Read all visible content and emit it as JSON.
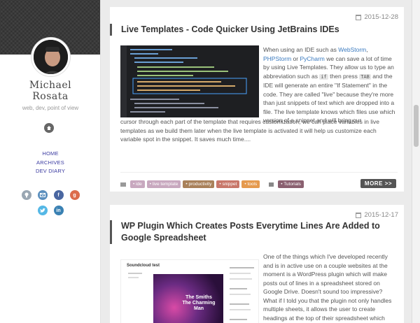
{
  "author": {
    "name_line1": "Michael",
    "name_line2": "Rosata",
    "tagline": "web, dev, point of view"
  },
  "nav": {
    "items": [
      "HOME",
      "ARCHIVES",
      "DEV DIARY"
    ]
  },
  "social": {
    "icons": [
      "lightbulb-icon",
      "email-icon",
      "facebook-icon",
      "google-plus-icon",
      "twitter-icon",
      "linkedin-icon"
    ],
    "colors": {
      "lightbulb": "#9aa7b3",
      "email": "#5b8fbe",
      "facebook": "#4a67a1",
      "google": "#dc6c4c",
      "twitter": "#55b8e6",
      "linkedin": "#3a81b3"
    }
  },
  "posts": [
    {
      "date": "2015-12-28",
      "title": "Live Templates - Code Quicker Using JetBrains IDEs",
      "excerpt_a": "When using an IDE such as ",
      "link1": "WebStorm",
      "sep1": ", ",
      "link2": "PHPStorm",
      "sep2": " or ",
      "link3": "PyCharm",
      "excerpt_b": " we can save a lot of time by using Live Templates. They allow us to type an abbreviation such as ",
      "chip1": "if",
      "excerpt_c": " then press ",
      "chip2": "TAB",
      "excerpt_d": " and the IDE will generate an entire \"If Statement\" in the code. They are called \"live\" because they're more than just snippets of text which are dropped into a file. The live template knows which files use which version of a snippet and will bring our",
      "excerpt_full": "cursor through each part of the template that requires customization, we can place variables in live templates as we build them later when the live template is activated it will help us customize each variable spot in the snippet. It saves much time....",
      "tags": [
        {
          "label": "ide",
          "color": "#c8a8bf"
        },
        {
          "label": "live template",
          "color": "#c8a8bf"
        },
        {
          "label": "productivity",
          "color": "#a9815a"
        },
        {
          "label": "snippet",
          "color": "#c8776a"
        },
        {
          "label": "tools",
          "color": "#e59a4e"
        }
      ],
      "category": {
        "label": "Tutorials",
        "color": "#8a6070"
      },
      "more_label": "MORE >>"
    },
    {
      "date": "2015-12-17",
      "title_line1": "WP Plugin Which Creates Posts Everytime Lines Are Added to",
      "title_line2": "Google Spreadsheet",
      "excerpt": "One of the things which I've developed recently and is in active use on a couple websites at the moment is a WordPress plugin which will make posts out of lines in a spreadsheet stored on Google Drive. Doesn't sound too impressive? What if I told you that the plugin not only handles multiple sheets, it allows the user to create headings at the top of their spreadsheet which",
      "thumb_site_title": "Soundcloud test",
      "thumb_album_line1": "The Smiths",
      "thumb_album_line2": "The Charming Man"
    }
  ]
}
